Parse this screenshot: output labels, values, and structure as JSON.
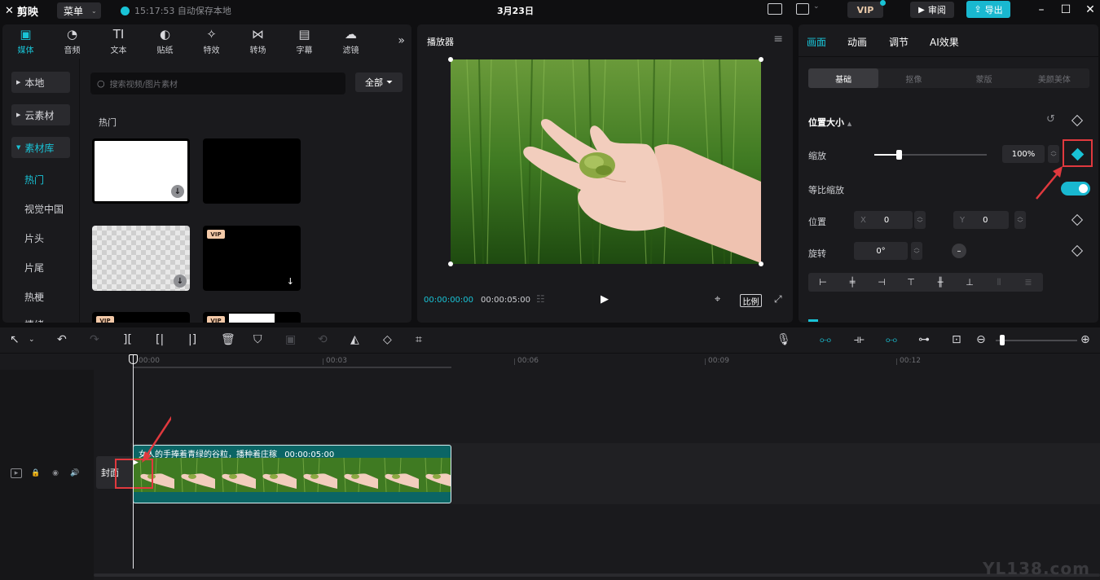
{
  "app": {
    "logo_text": "剪映",
    "menu_label": "菜单",
    "save_status": "15:17:53 自动保存本地",
    "doc_title": "3月23日",
    "vip_label": "VIP",
    "review_label": "审阅",
    "export_label": "导出"
  },
  "media_tabs": [
    {
      "label": "媒体",
      "icon": "media-icon",
      "glyph": "▣"
    },
    {
      "label": "音频",
      "icon": "audio-icon",
      "glyph": "◔"
    },
    {
      "label": "文本",
      "icon": "text-icon",
      "glyph": "TI"
    },
    {
      "label": "贴纸",
      "icon": "sticker-icon",
      "glyph": "◐"
    },
    {
      "label": "特效",
      "icon": "effects-icon",
      "glyph": "✧"
    },
    {
      "label": "转场",
      "icon": "transition-icon",
      "glyph": "⋈"
    },
    {
      "label": "字幕",
      "icon": "subtitle-icon",
      "glyph": "▤"
    },
    {
      "label": "滤镜",
      "icon": "filter-icon",
      "glyph": "☁"
    }
  ],
  "sidebar": {
    "items": [
      {
        "label": "本地"
      },
      {
        "label": "云素材"
      },
      {
        "label": "素材库"
      }
    ],
    "sub_items": [
      "热门",
      "视觉中国",
      "片头",
      "片尾",
      "热梗",
      "情绪"
    ]
  },
  "library": {
    "search_placeholder": "搜索视频/图片素材",
    "filter_label": "全部",
    "section": "热门",
    "vip_tag": "VIP"
  },
  "player": {
    "title": "播放器",
    "current_time": "00:00:00:00",
    "total_time": "00:00:05:00",
    "ratio_label": "比例"
  },
  "inspector": {
    "tabs": [
      "画面",
      "动画",
      "调节",
      "AI效果"
    ],
    "sub_tabs": [
      "基础",
      "抠像",
      "蒙版",
      "美颜美体"
    ],
    "section_title": "位置大小",
    "scale_label": "缩放",
    "scale_value": "100%",
    "scale_fraction": 0.22,
    "uniform_label": "等比缩放",
    "uniform_on": true,
    "position_label": "位置",
    "x_label": "X",
    "x_value": "0",
    "y_label": "Y",
    "y_value": "0",
    "rotate_label": "旋转",
    "rotate_value": "0°"
  },
  "timeline": {
    "ruler_labels": [
      "00:00",
      "00:03",
      "00:06",
      "00:09",
      "00:12"
    ],
    "cover_label": "封面",
    "clip_title": "女人的手捧着青绿的谷粒，播种着庄稼",
    "clip_duration": "00:00:05:00"
  },
  "watermark": "YL138.com",
  "colors": {
    "accent": "#19c3d6",
    "highlight": "#e0393e",
    "clip": "#0b6565"
  }
}
